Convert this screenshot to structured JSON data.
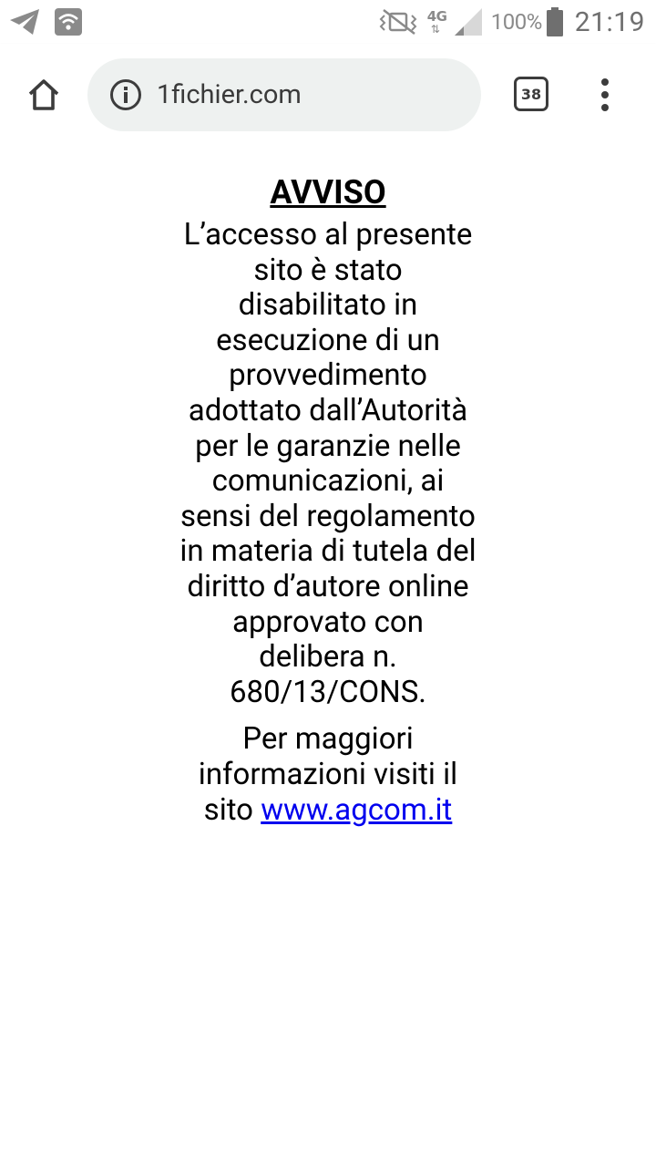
{
  "status_bar": {
    "network_type": "4G",
    "network_arrows": "⇅",
    "battery_percent": "100%",
    "time": "21:19"
  },
  "browser": {
    "url": "1fichier.com",
    "tab_count": "38"
  },
  "notice": {
    "title": "AVVISO",
    "body": "L’accesso al presente sito è stato disabilitato in esecuzione di un provvedimento adottato dall’Autorità per le garanzie nelle comunicazioni, ai sensi del regolamento in materia di tutela del diritto d’autore online approvato con delibera n. 680/13/CONS.",
    "more_info_prefix": "Per maggiori informazioni visiti il sito",
    "link_text": "www.agcom.it"
  },
  "colors": {
    "link": "#0000ee",
    "omnibox_bg": "#eef1f0",
    "status_icon_gray": "#8a8a8a"
  },
  "icons": {
    "status_left": [
      "telegram-icon",
      "wifi-notification-icon"
    ],
    "status_right": [
      "vibrate-icon",
      "network-4g-icon",
      "signal-icon",
      "battery-icon"
    ],
    "toolbar": [
      "home-icon",
      "info-icon",
      "tab-switcher-icon",
      "overflow-menu-icon"
    ]
  }
}
